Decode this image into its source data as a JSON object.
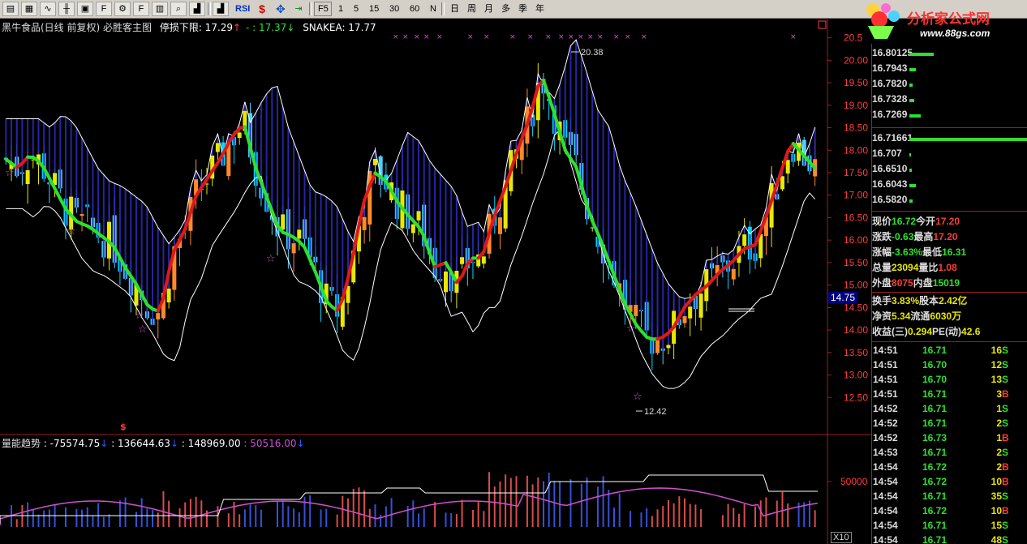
{
  "toolbar": {
    "icons": [
      "file-icon",
      "grid-icon",
      "line-chart-icon",
      "candle-icon",
      "tile-icon",
      "f10-icon",
      "gear-icon",
      "fz-icon",
      "book-icon",
      "search-icon",
      "bar-chart-icon"
    ],
    "rsi": "RSI",
    "dollar": "$",
    "arrows": "✥",
    "export": "⇥",
    "periods": [
      "F5",
      "1",
      "5",
      "15",
      "30",
      "60",
      "N"
    ],
    "periods2": [
      "日",
      "周",
      "月",
      "多",
      "季",
      "年"
    ]
  },
  "logo": {
    "title": "分析家公式网",
    "url": "www.88gs.com"
  },
  "main": {
    "title": "黑牛食品(日线 前复权) 必胜客主图",
    "stop_label": "停损下限: 17.29",
    "mid_label": "- : 17.37",
    "snake_label": "SNAKEA: 17.77"
  },
  "volume": {
    "title": "量能趋势",
    "v1": ": -75574.75",
    "v2": ": 136644.63",
    "v3": ": 148969.00",
    "v4": ": 50516.00"
  },
  "colors": {
    "up": "#ff4040",
    "down": "#00d8ff",
    "yellow": "#e8e800",
    "green": "#2ee02e",
    "cloud": "#2020a0",
    "axis": "#9a2020"
  },
  "chart_data": {
    "type": "candlestick",
    "ylim": [
      12.0,
      20.8
    ],
    "yticks": [
      "20.5",
      "20.00",
      "19.50",
      "19.00",
      "18.50",
      "18.00",
      "17.50",
      "17.00",
      "16.50",
      "16.00",
      "15.50",
      "15.00",
      "14.50",
      "14.00",
      "13.50",
      "13.00",
      "12.50"
    ],
    "high_label": "20.38",
    "low_label": "12.42",
    "current_price": "14.75",
    "close": [
      17.8,
      17.6,
      17.9,
      17.7,
      17.2,
      16.7,
      16.4,
      16.3,
      16.1,
      15.9,
      15.4,
      15.0,
      14.5,
      14.4,
      15.7,
      16.2,
      17.0,
      17.4,
      17.8,
      18.3,
      18.6,
      17.6,
      16.9,
      16.2,
      16.1,
      15.9,
      15.3,
      14.6,
      14.4,
      15.4,
      16.8,
      17.5,
      17.3,
      16.8,
      16.5,
      16.2,
      15.4,
      15.5,
      15.0,
      15.6,
      15.6,
      16.5,
      17.2,
      18.0,
      18.7,
      19.7,
      18.9,
      18.0,
      17.6,
      16.6,
      16.0,
      15.3,
      14.6,
      14.1,
      13.8,
      13.8,
      14.0,
      14.5,
      14.8,
      15.0,
      15.3,
      15.5,
      15.8,
      15.9,
      16.6,
      17.4,
      18.2,
      17.9,
      17.6
    ],
    "volume_max": 100000,
    "volume_tick": "50000",
    "x10_label": "X10"
  },
  "orderbook": {
    "asks": [
      {
        "p": "16.80",
        "v": "125",
        "w": 30
      },
      {
        "p": "16.79",
        "v": "43",
        "w": 8
      },
      {
        "p": "16.78",
        "v": "20",
        "w": 4
      },
      {
        "p": "16.73",
        "v": "28",
        "w": 6
      },
      {
        "p": "16.72",
        "v": "69",
        "w": 14
      }
    ],
    "bids": [
      {
        "p": "16.71",
        "v": "661",
        "w": 145
      },
      {
        "p": "16.70",
        "v": "7",
        "w": 2
      },
      {
        "p": "16.65",
        "v": "10",
        "w": 3
      },
      {
        "p": "16.60",
        "v": "43",
        "w": 8
      },
      {
        "p": "16.58",
        "v": "20",
        "w": 4
      }
    ]
  },
  "quote": [
    {
      "l1": "现价",
      "v1": "16.72",
      "c1": "#2ee02e",
      "l2": "今开",
      "v2": "17.20",
      "c2": "#ff3b3b"
    },
    {
      "l1": "涨跌",
      "v1": "-0.63",
      "c1": "#2ee02e",
      "l2": "最高",
      "v2": "17.20",
      "c2": "#ff3b3b"
    },
    {
      "l1": "涨幅",
      "v1": "-3.63%",
      "c1": "#2ee02e",
      "l2": "最低",
      "v2": "16.31",
      "c2": "#2ee02e"
    },
    {
      "l1": "总量",
      "v1": "23094",
      "c1": "#e8e800",
      "l2": "量比",
      "v2": "1.08",
      "c2": "#ff3b3b"
    },
    {
      "l1": "外盘",
      "v1": "8075",
      "c1": "#ff3b3b",
      "l2": "内盘",
      "v2": "15019",
      "c2": "#2ee02e"
    },
    {
      "l1": "换手",
      "v1": "3.83%",
      "c1": "#e8e800",
      "l2": "股本",
      "v2": "2.42亿",
      "c2": "#e8e800"
    },
    {
      "l1": "净资",
      "v1": "5.34",
      "c1": "#e8e800",
      "l2": "流通",
      "v2": "6030万",
      "c2": "#e8e800"
    },
    {
      "l1": "收益(三)",
      "v1": "0.294",
      "c1": "#e8e800",
      "l2": "PE(动)",
      "v2": "42.6",
      "c2": "#e8e800"
    }
  ],
  "ticks": [
    {
      "t": "14:51",
      "p": "16.71",
      "q": "16",
      "s": "S"
    },
    {
      "t": "14:51",
      "p": "16.70",
      "q": "12",
      "s": "S"
    },
    {
      "t": "14:51",
      "p": "16.70",
      "q": "13",
      "s": "S"
    },
    {
      "t": "14:51",
      "p": "16.71",
      "q": "3",
      "s": "B"
    },
    {
      "t": "14:52",
      "p": "16.71",
      "q": "1",
      "s": "S"
    },
    {
      "t": "14:52",
      "p": "16.71",
      "q": "2",
      "s": "S"
    },
    {
      "t": "14:52",
      "p": "16.73",
      "q": "1",
      "s": "B"
    },
    {
      "t": "14:53",
      "p": "16.71",
      "q": "2",
      "s": "S"
    },
    {
      "t": "14:54",
      "p": "16.72",
      "q": "2",
      "s": "B"
    },
    {
      "t": "14:54",
      "p": "16.72",
      "q": "10",
      "s": "B"
    },
    {
      "t": "14:54",
      "p": "16.71",
      "q": "35",
      "s": "S"
    },
    {
      "t": "14:54",
      "p": "16.72",
      "q": "10",
      "s": "B"
    },
    {
      "t": "14:54",
      "p": "16.71",
      "q": "15",
      "s": "S"
    },
    {
      "t": "14:54",
      "p": "16.71",
      "q": "48",
      "s": "S"
    }
  ]
}
